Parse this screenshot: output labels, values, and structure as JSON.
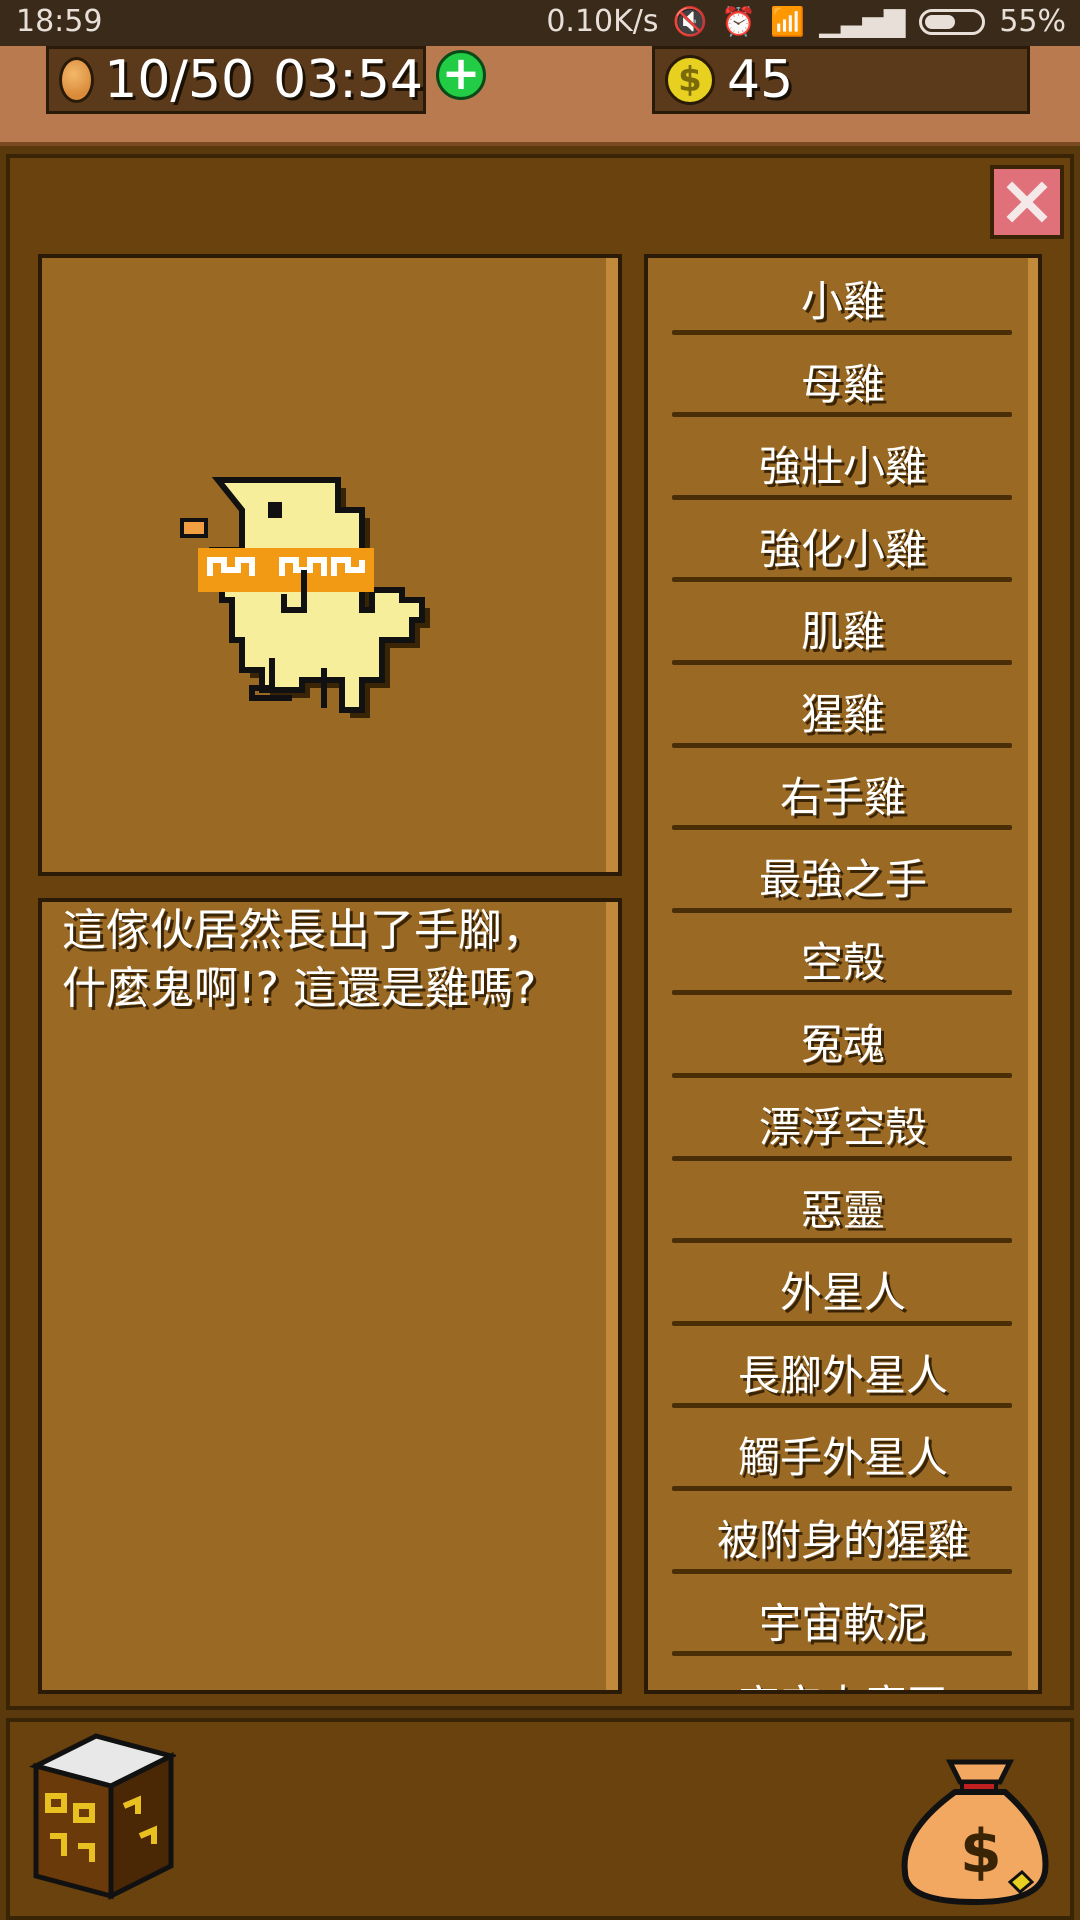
{
  "status_bar": {
    "time": "18:59",
    "network_speed": "0.10K/s",
    "battery_percent": "55%",
    "battery_level": 0.55,
    "icons": [
      "mute-icon",
      "alarm-icon",
      "wifi-icon",
      "signal-icon",
      "battery-icon"
    ]
  },
  "resources": {
    "energy": "10/50",
    "timer": "03:54",
    "coins": "45",
    "coin_symbol": "$",
    "plus_symbol": "+"
  },
  "detail": {
    "description": "這傢伙居然長出了手腳，\n什麼鬼啊!? 這還是雞嗎?"
  },
  "collection": {
    "items": [
      "小雞",
      "母雞",
      "強壯小雞",
      "強化小雞",
      "肌雞",
      "猩雞",
      "右手雞",
      "最強之手",
      "空殼",
      "冤魂",
      "漂浮空殼",
      "惡靈",
      "外星人",
      "長腳外星人",
      "觸手外星人",
      "被附身的猩雞",
      "宇宙軟泥",
      "宇宙大魔王"
    ]
  },
  "colors": {
    "panel": "#6a420e",
    "card": "#9a6a24",
    "top_bar": "#b87a4e",
    "close_button": "#e0707a",
    "plus_button": "#22cc44"
  }
}
